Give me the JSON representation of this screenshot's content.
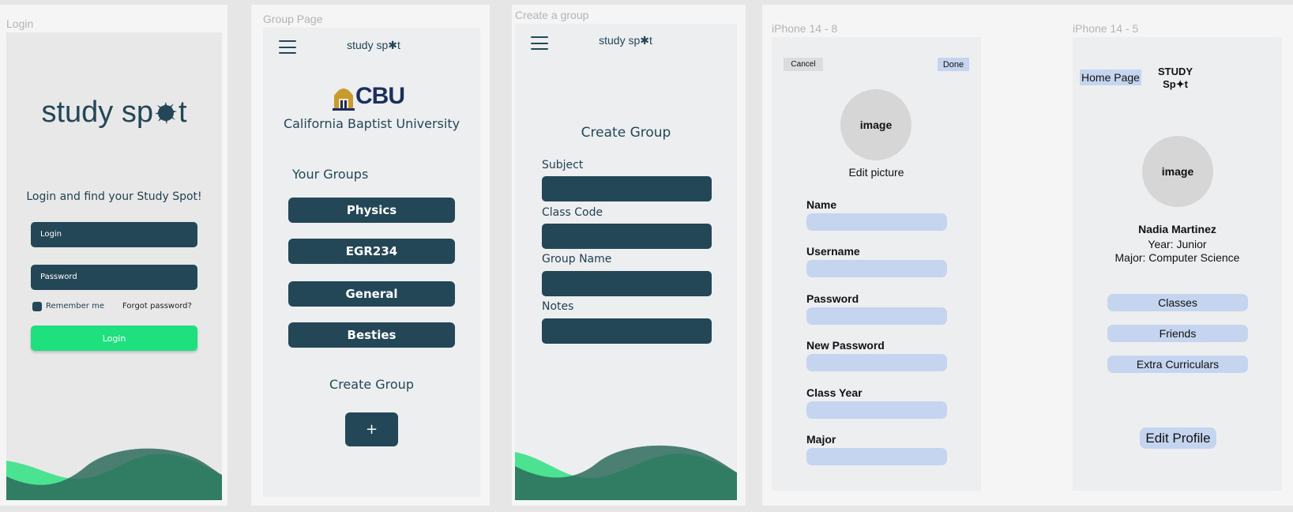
{
  "login": {
    "frame_label": "Login",
    "logo": "study sp",
    "logo_tail": "t",
    "tagline": "Login and find your Study Spot!",
    "login_placeholder": "Login",
    "password_placeholder": "Password",
    "remember_me": "Remember me",
    "forgot_password": "Forgot password?",
    "login_button": "Login"
  },
  "group_page": {
    "frame_label": "Group Page",
    "app_logo": "study sp✱t",
    "cbu_letters": "CBU",
    "university": "California Baptist University",
    "your_groups": "Your Groups",
    "groups": [
      {
        "label": "Physics"
      },
      {
        "label": "EGR234"
      },
      {
        "label": "General"
      },
      {
        "label": "Besties"
      }
    ],
    "create_group": "Create Group",
    "add_button": "+"
  },
  "create_group": {
    "frame_label": "Create a group",
    "app_logo": "study sp✱t",
    "title": "Create Group",
    "fields": [
      {
        "label": "Subject",
        "value": ""
      },
      {
        "label": "Class Code",
        "value": ""
      },
      {
        "label": "Group Name",
        "value": ""
      },
      {
        "label": "Notes",
        "value": ""
      }
    ]
  },
  "edit_profile": {
    "frame_label": "iPhone 14 - 8",
    "cancel": "Cancel",
    "done": "Done",
    "image": "image",
    "edit_picture": "Edit picture",
    "fields": [
      {
        "label": "Name",
        "value": ""
      },
      {
        "label": "Username",
        "value": ""
      },
      {
        "label": "Password",
        "value": ""
      },
      {
        "label": "New Password",
        "value": ""
      },
      {
        "label": "Class Year",
        "value": ""
      },
      {
        "label": "Major",
        "value": ""
      }
    ]
  },
  "profile": {
    "frame_label": "iPhone 14 - 5",
    "home_page": "Home Page",
    "logo_line1": "STUDY",
    "logo_line2": "Sp✦t",
    "image": "image",
    "name": "Nadia Martinez",
    "year": "Year: Junior",
    "major": "Major: Computer Science",
    "buttons": [
      {
        "label": "Classes"
      },
      {
        "label": "Friends"
      },
      {
        "label": "Extra Curriculars"
      }
    ],
    "edit_profile": "Edit Profile"
  },
  "colors": {
    "teal": "#234756",
    "green": "#1fe07f",
    "light_blue": "#c6d5ef",
    "cbu_gold": "#c99a2e",
    "cbu_navy": "#1c2f5c"
  }
}
